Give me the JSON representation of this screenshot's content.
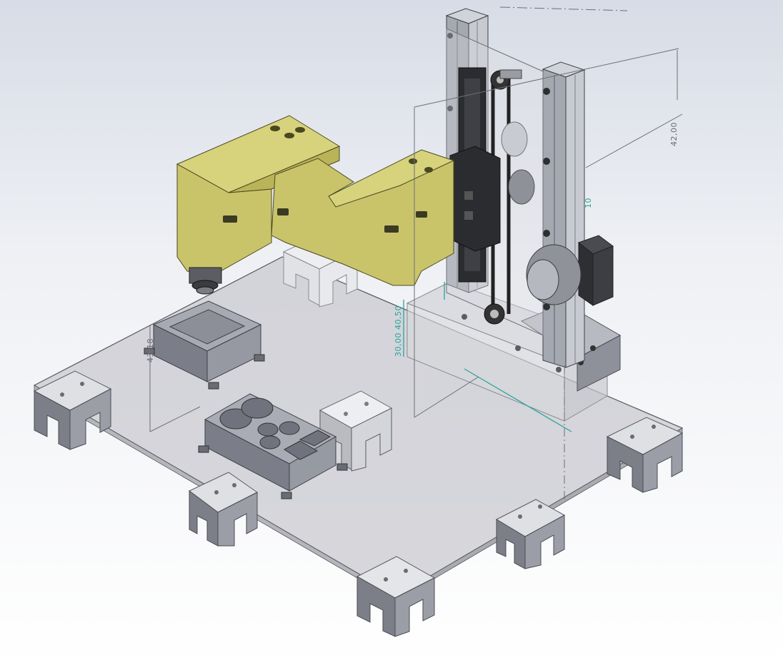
{
  "view": {
    "background_top": "#d7dce6",
    "background_bottom": "#ffffff"
  },
  "model": {
    "colors": {
      "arm": "#c9c46a",
      "arm_shadow": "#8f8a3a",
      "aluminum": "#b9bcc4",
      "dark_part": "#2b2c30",
      "motor": "#3a3b40",
      "plate": "#c9cad0",
      "dimension_gray": "#6d6f76",
      "dimension_teal": "#2aa39a"
    }
  },
  "dimensions": {
    "d1": "42,00",
    "d2": "43,18",
    "d3": "30,00 40,50",
    "d4": "10"
  }
}
